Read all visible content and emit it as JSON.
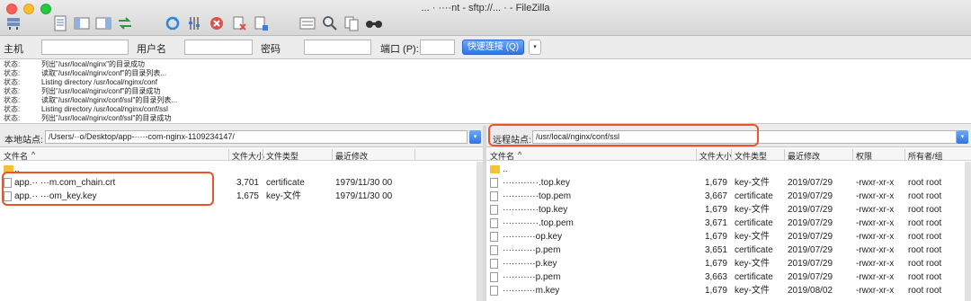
{
  "window": {
    "title": "... · ····nt - sftp://... · - FileZilla"
  },
  "toolbar": {
    "icons": [
      "site-manager-icon",
      "toggle-log-icon",
      "toggle-local-tree-icon",
      "toggle-remote-tree-icon",
      "transfer-queue-icon",
      "refresh-icon",
      "process-queue-icon",
      "cancel-icon",
      "disconnect-icon",
      "reconnect-icon",
      "filter-icon",
      "search-icon",
      "compare-icon",
      "find-icon"
    ]
  },
  "quickconnect": {
    "host_label": "主机",
    "user_label": "用户名",
    "pass_label": "密码",
    "port_label": "端口 (P):",
    "button": "快速连接 (Q)",
    "dropdown": "▾"
  },
  "log": [
    {
      "label": "状态:",
      "text": "列出\"/usr/local/nginx\"的目录成功"
    },
    {
      "label": "状态:",
      "text": "读取\"/usr/local/nginx/conf\"的目录列表..."
    },
    {
      "label": "状态:",
      "text": "Listing directory /usr/local/nginx/conf"
    },
    {
      "label": "状态:",
      "text": "列出\"/usr/local/nginx/conf\"的目录成功"
    },
    {
      "label": "状态:",
      "text": "读取\"/usr/local/nginx/conf/ssl\"的目录列表..."
    },
    {
      "label": "状态:",
      "text": "Listing directory /usr/local/nginx/conf/ssl"
    },
    {
      "label": "状态:",
      "text": "列出\"/usr/local/nginx/conf/ssl\"的目录成功"
    }
  ],
  "local": {
    "site_label": "本地站点:",
    "path": "/Users/··o/Desktop/app-····-com-nginx-1109234147/",
    "columns": [
      "文件名",
      "文件大小",
      "文件类型",
      "最近修改"
    ],
    "files": [
      {
        "name": "..",
        "size": "",
        "type": "",
        "modified": ""
      },
      {
        "name": "app.··  ···m.com_chain.crt",
        "size": "3,701",
        "type": "certificate",
        "modified": "1979/11/30 00"
      },
      {
        "name": "app.··  ···om_key.key",
        "size": "1,675",
        "type": "key-文件",
        "modified": "1979/11/30 00"
      }
    ]
  },
  "remote": {
    "site_label": "远程站点:",
    "path": "/usr/local/nginx/conf/ssl",
    "columns": [
      "文件名",
      "文件大小",
      "文件类型",
      "最近修改",
      "权限",
      "所有者/组"
    ],
    "files": [
      {
        "name": "..",
        "size": "",
        "type": "",
        "modified": "",
        "perms": "",
        "owner": ""
      },
      {
        "name": "············.top.key",
        "size": "1,679",
        "type": "key-文件",
        "modified": "2019/07/29",
        "perms": "-rwxr-xr-x",
        "owner": "root root"
      },
      {
        "name": "············top.pem",
        "size": "3,667",
        "type": "certificate",
        "modified": "2019/07/29",
        "perms": "-rwxr-xr-x",
        "owner": "root root"
      },
      {
        "name": "············top.key",
        "size": "1,679",
        "type": "key-文件",
        "modified": "2019/07/29",
        "perms": "-rwxr-xr-x",
        "owner": "root root"
      },
      {
        "name": "············.top.pem",
        "size": "3,671",
        "type": "certificate",
        "modified": "2019/07/29",
        "perms": "-rwxr-xr-x",
        "owner": "root root"
      },
      {
        "name": "···········op.key",
        "size": "1,679",
        "type": "key-文件",
        "modified": "2019/07/29",
        "perms": "-rwxr-xr-x",
        "owner": "root root"
      },
      {
        "name": "···········p.pem",
        "size": "3,651",
        "type": "certificate",
        "modified": "2019/07/29",
        "perms": "-rwxr-xr-x",
        "owner": "root root"
      },
      {
        "name": "···········p.key",
        "size": "1,679",
        "type": "key-文件",
        "modified": "2019/07/29",
        "perms": "-rwxr-xr-x",
        "owner": "root root"
      },
      {
        "name": "···········p.pem",
        "size": "3,663",
        "type": "certificate",
        "modified": "2019/07/29",
        "perms": "-rwxr-xr-x",
        "owner": "root root"
      },
      {
        "name": "···········m.key",
        "size": "1,679",
        "type": "key-文件",
        "modified": "2019/08/02",
        "perms": "-rwxr-xr-x",
        "owner": "root root"
      }
    ]
  },
  "colors": {
    "highlight": "#e8542c",
    "accent": "#2f74e3",
    "folder": "#f3c13a"
  }
}
